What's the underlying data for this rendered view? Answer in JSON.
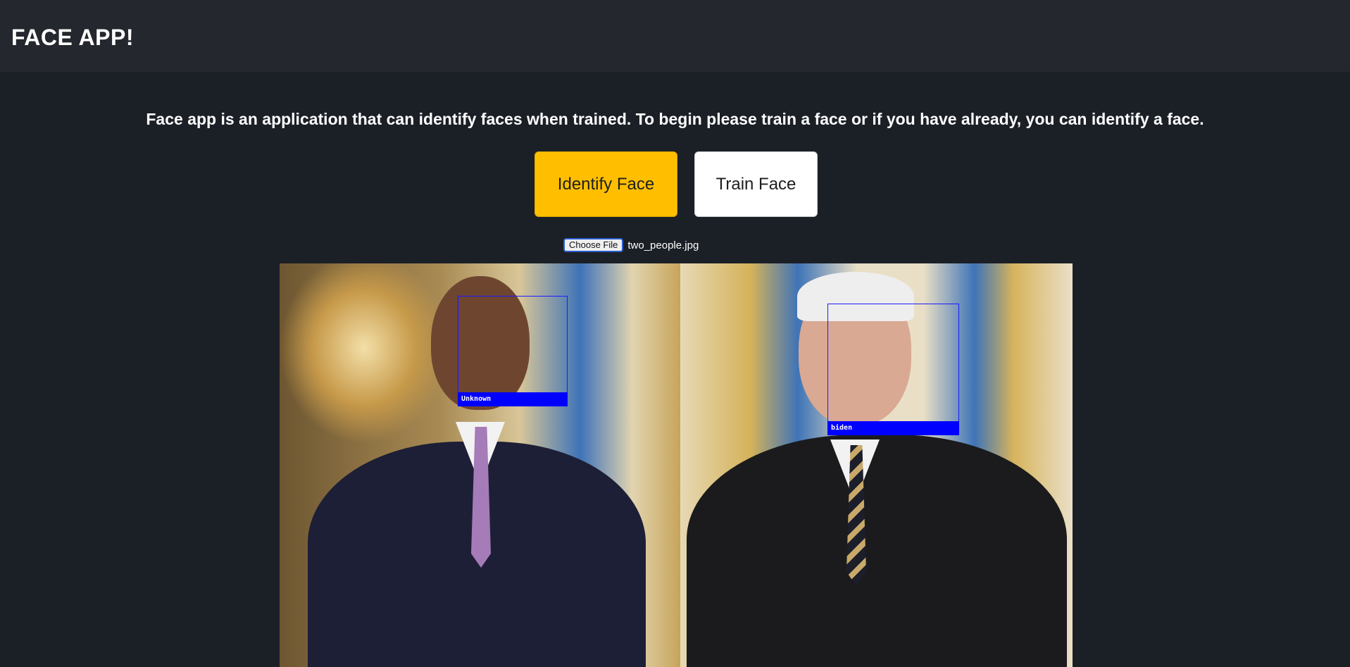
{
  "header": {
    "title": "FACE APP!"
  },
  "intro": {
    "text": "Face app is an application that can identify faces when trained. To begin please train a face or if you have already, you can identify a face."
  },
  "actions": {
    "identify_label": "Identify Face",
    "train_label": "Train Face"
  },
  "file_input": {
    "button_label": "Choose File",
    "file_name": "two_people.jpg"
  },
  "result": {
    "faces": [
      {
        "label": "Unknown"
      },
      {
        "label": "biden"
      }
    ]
  },
  "colors": {
    "page_background": "#1b1f26",
    "header_background": "#24272e",
    "identify_button": "#ffbf00",
    "train_button": "#ffffff",
    "face_box": "#0000ff"
  }
}
